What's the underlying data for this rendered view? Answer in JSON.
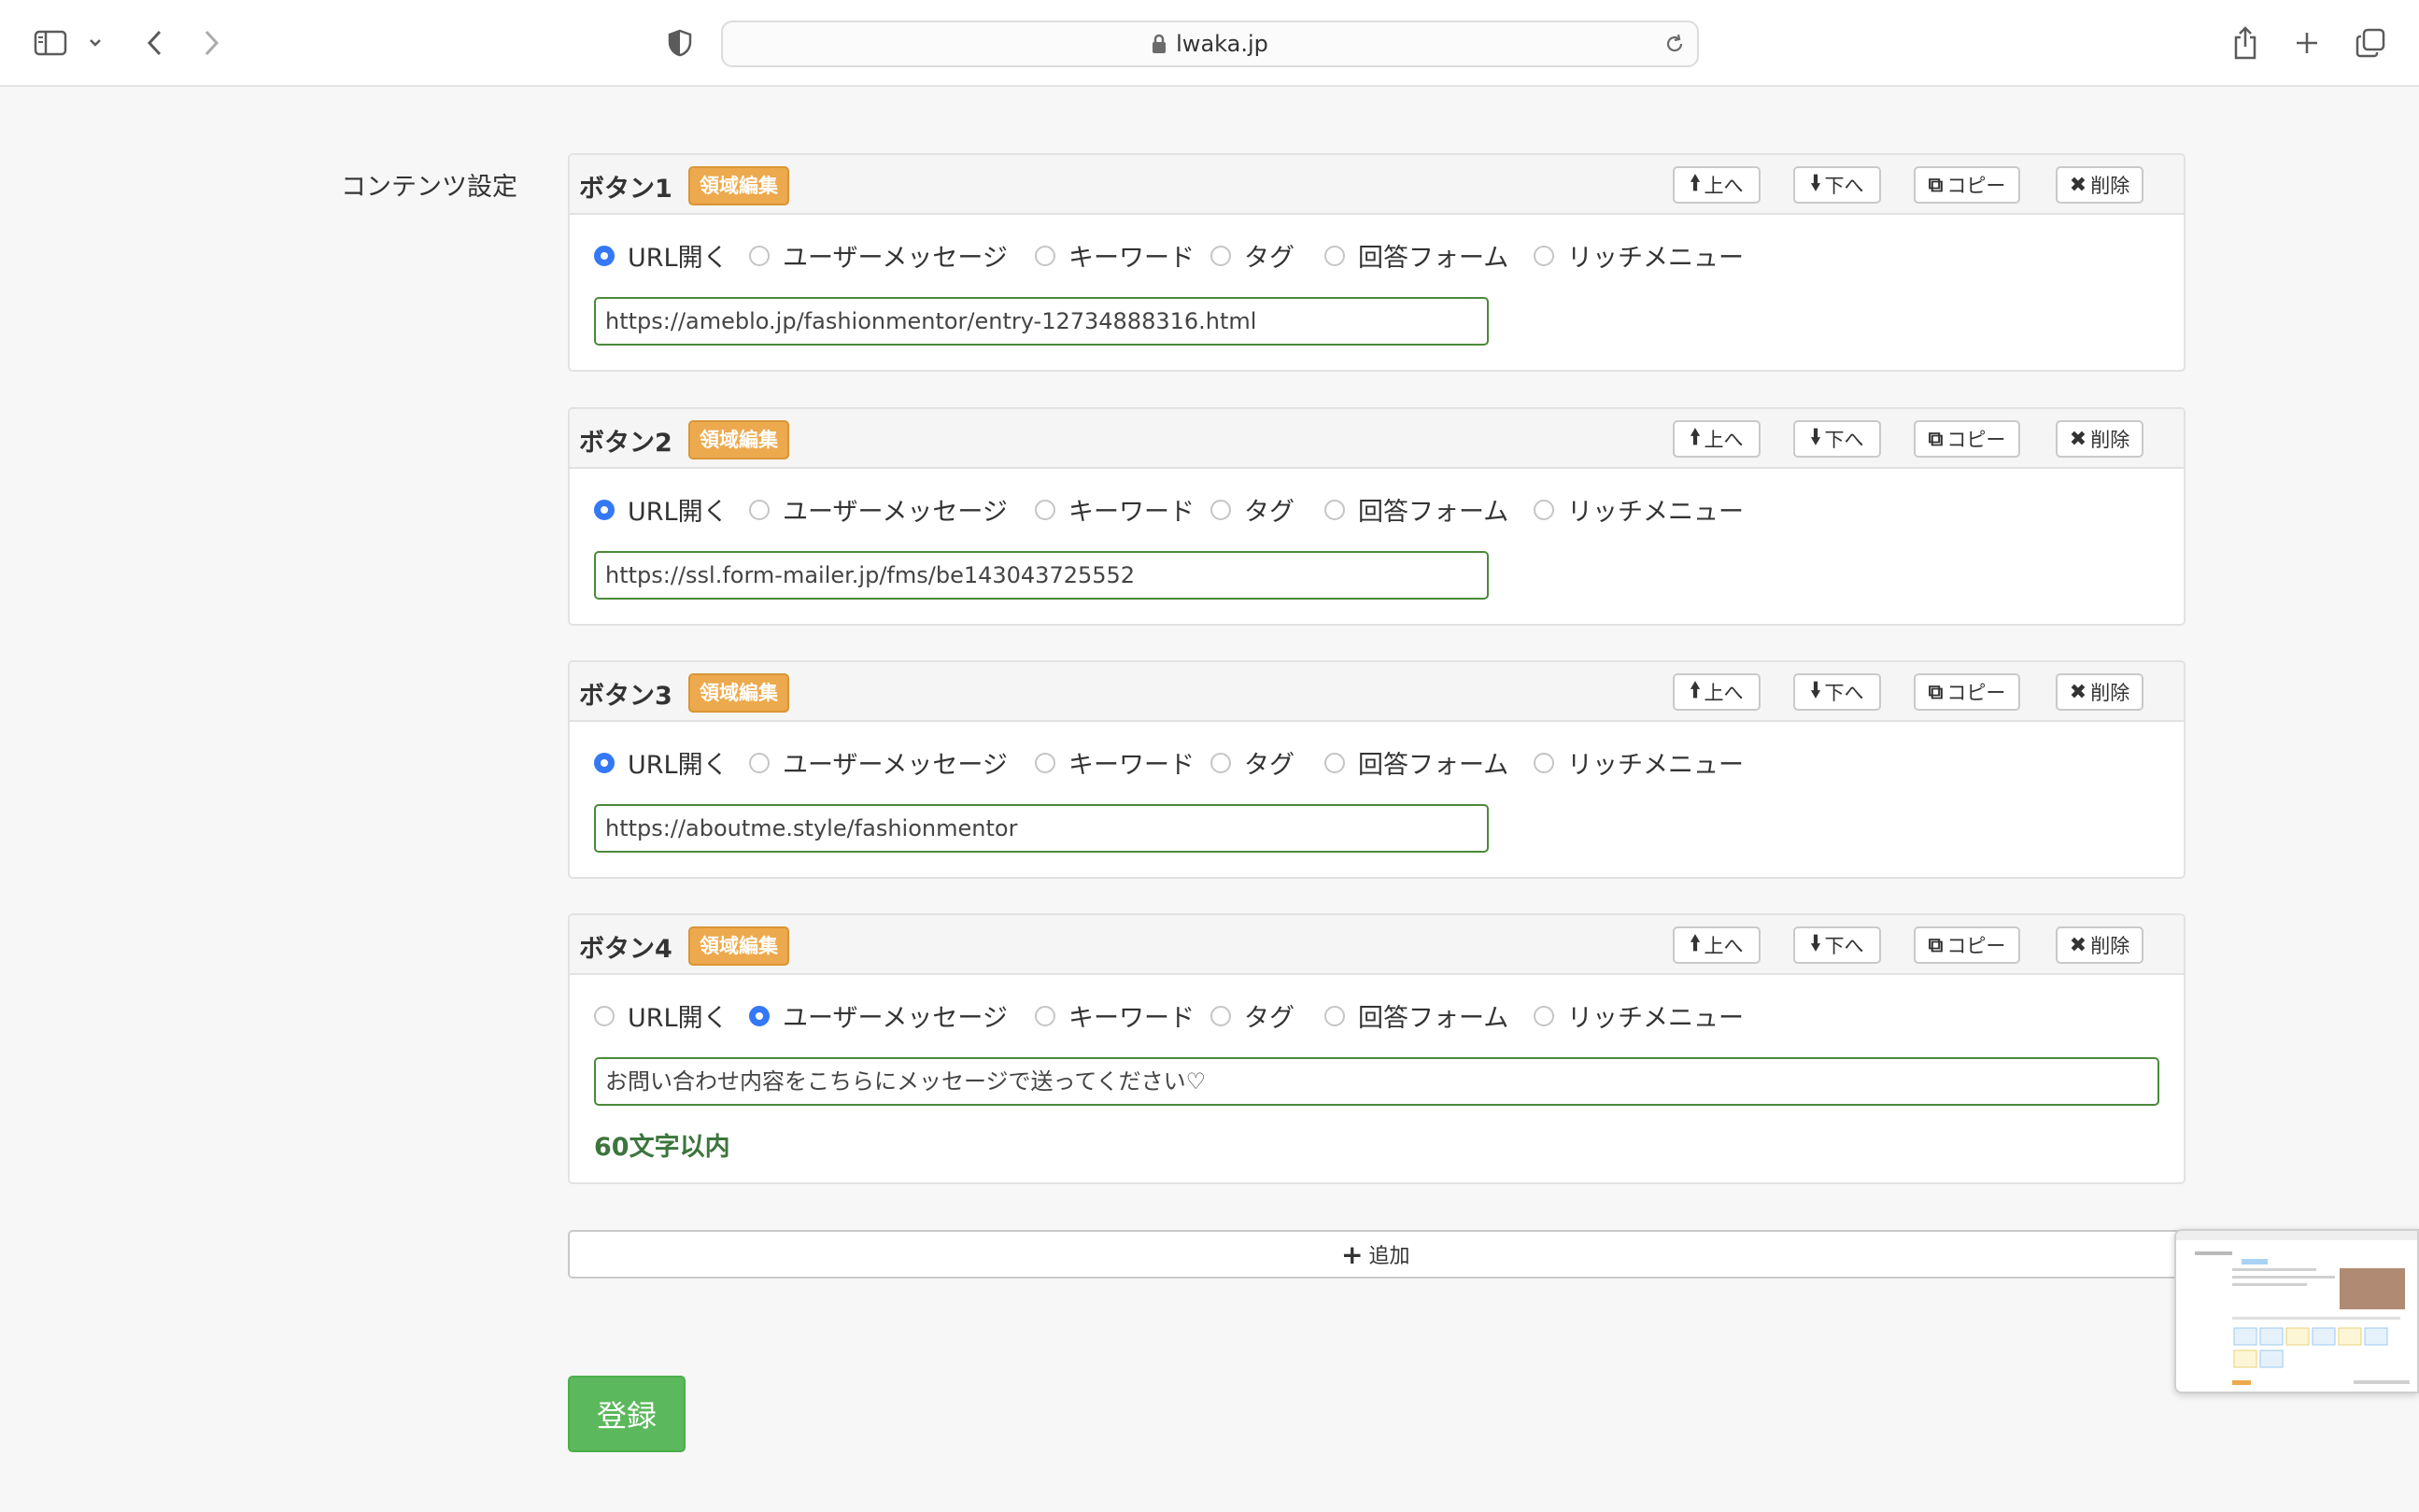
{
  "browser": {
    "url": "lwaka.jp"
  },
  "page": {
    "section_label": "コンテンツ設定",
    "panel_actions": {
      "up": "上へ",
      "down": "下へ",
      "copy": "コピー",
      "delete": "削除"
    },
    "badge_label": "領域編集",
    "radio_options": [
      "URL開く",
      "ユーザーメッセージ",
      "キーワード",
      "タグ",
      "回答フォーム",
      "リッチメニュー"
    ],
    "buttons": [
      {
        "title": "ボタン1",
        "selected": 0,
        "value": "https://ameblo.jp/fashionmentor/entry-12734888316.html"
      },
      {
        "title": "ボタン2",
        "selected": 0,
        "value": "https://ssl.form-mailer.jp/fms/be143043725552"
      },
      {
        "title": "ボタン3",
        "selected": 0,
        "value": "https://aboutme.style/fashionmentor"
      },
      {
        "title": "ボタン4",
        "selected": 1,
        "value": "お問い合わせ内容をこちらにメッセージで送ってください♡",
        "hint": "60文字以内"
      }
    ],
    "add_label": "追加",
    "submit_label": "登録"
  }
}
